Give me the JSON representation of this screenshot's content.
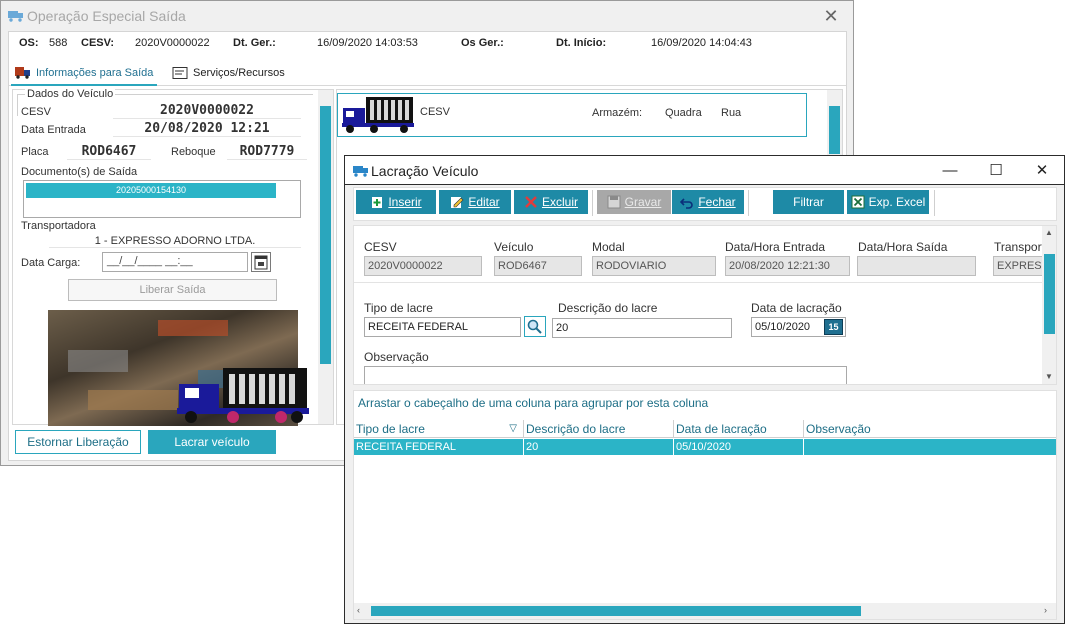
{
  "back_window": {
    "title": "Operação Especial Saída",
    "header": {
      "os_label": "OS:",
      "os_value": "588",
      "cesv_label": "CESV:",
      "cesv_value": "2020V0000022",
      "dtger_label": "Dt. Ger.:",
      "dtger_value": "16/09/2020 14:03:53",
      "osger_label": "Os Ger.:",
      "osger_value": "",
      "dtinicio_label": "Dt. Início:",
      "dtinicio_value": "16/09/2020 14:04:43"
    },
    "tabs": [
      {
        "label": "Informações para Saída",
        "active": true
      },
      {
        "label": "Serviços/Recursos",
        "active": false
      }
    ],
    "left_panel": {
      "group_title": "Dados do Veículo",
      "cesv_label": "CESV",
      "cesv_value": "2020V0000022",
      "data_entrada_label": "Data Entrada",
      "data_entrada_value": "20/08/2020 12:21",
      "placa_label": "Placa",
      "placa_value": "ROD6467",
      "reboque_label": "Reboque",
      "reboque_value": "ROD7779",
      "docs_label": "Documento(s) de Saída",
      "docs_row": "20205000154130",
      "transportadora_label": "Transportadora",
      "transportadora_value": "1 - EXPRESSO ADORNO LTDA.",
      "data_carga_label": "Data Carga:",
      "data_carga_value": "__/__/____ __:__",
      "liberar_label": "Liberar Saída"
    },
    "right_panel": {
      "cesv_label": "CESV",
      "armazem_label": "Armazém:",
      "quadra_label": "Quadra",
      "rua_label": "Rua"
    },
    "buttons": {
      "estornar": "Estornar Liberação",
      "lacrar": "Lacrar veículo"
    }
  },
  "front_window": {
    "title": "Lacração Veículo",
    "toolbar": {
      "inserir": "Inserir",
      "editar": "Editar",
      "excluir": "Excluir",
      "gravar": "Gravar",
      "fechar": "Fechar",
      "filtrar": "Filtrar",
      "exp_excel": "Exp. Excel"
    },
    "form": {
      "cesv_label": "CESV",
      "cesv_value": "2020V0000022",
      "veiculo_label": "Veículo",
      "veiculo_value": "ROD6467",
      "modal_label": "Modal",
      "modal_value": "RODOVIARIO",
      "dh_entrada_label": "Data/Hora Entrada",
      "dh_entrada_value": "20/08/2020 12:21:30",
      "dh_saida_label": "Data/Hora Saída",
      "dh_saida_value": "",
      "transport_label": "Transport",
      "transport_value": "EXPRESS",
      "tipo_lacre_label": "Tipo de lacre",
      "tipo_lacre_value": "RECEITA FEDERAL",
      "descricao_label": "Descrição do lacre",
      "descricao_value": "20",
      "data_lacracao_label": "Data de lacração",
      "data_lacracao_value": "05/10/2020",
      "cal_badge": "15",
      "observacao_label": "Observação",
      "observacao_value": ""
    },
    "grid": {
      "group_hint": "Arrastar o cabeçalho de uma coluna para agrupar por esta coluna",
      "columns": [
        "Tipo de lacre",
        "Descrição do lacre",
        "Data de lacração",
        "Observação"
      ],
      "rows": [
        [
          "RECEITA FEDERAL",
          "20",
          "05/10/2020",
          ""
        ]
      ]
    }
  },
  "colors": {
    "accent": "#2aa6bd",
    "toolbar_button": "#1e8aa6",
    "selected_row": "#2bb4c7"
  }
}
